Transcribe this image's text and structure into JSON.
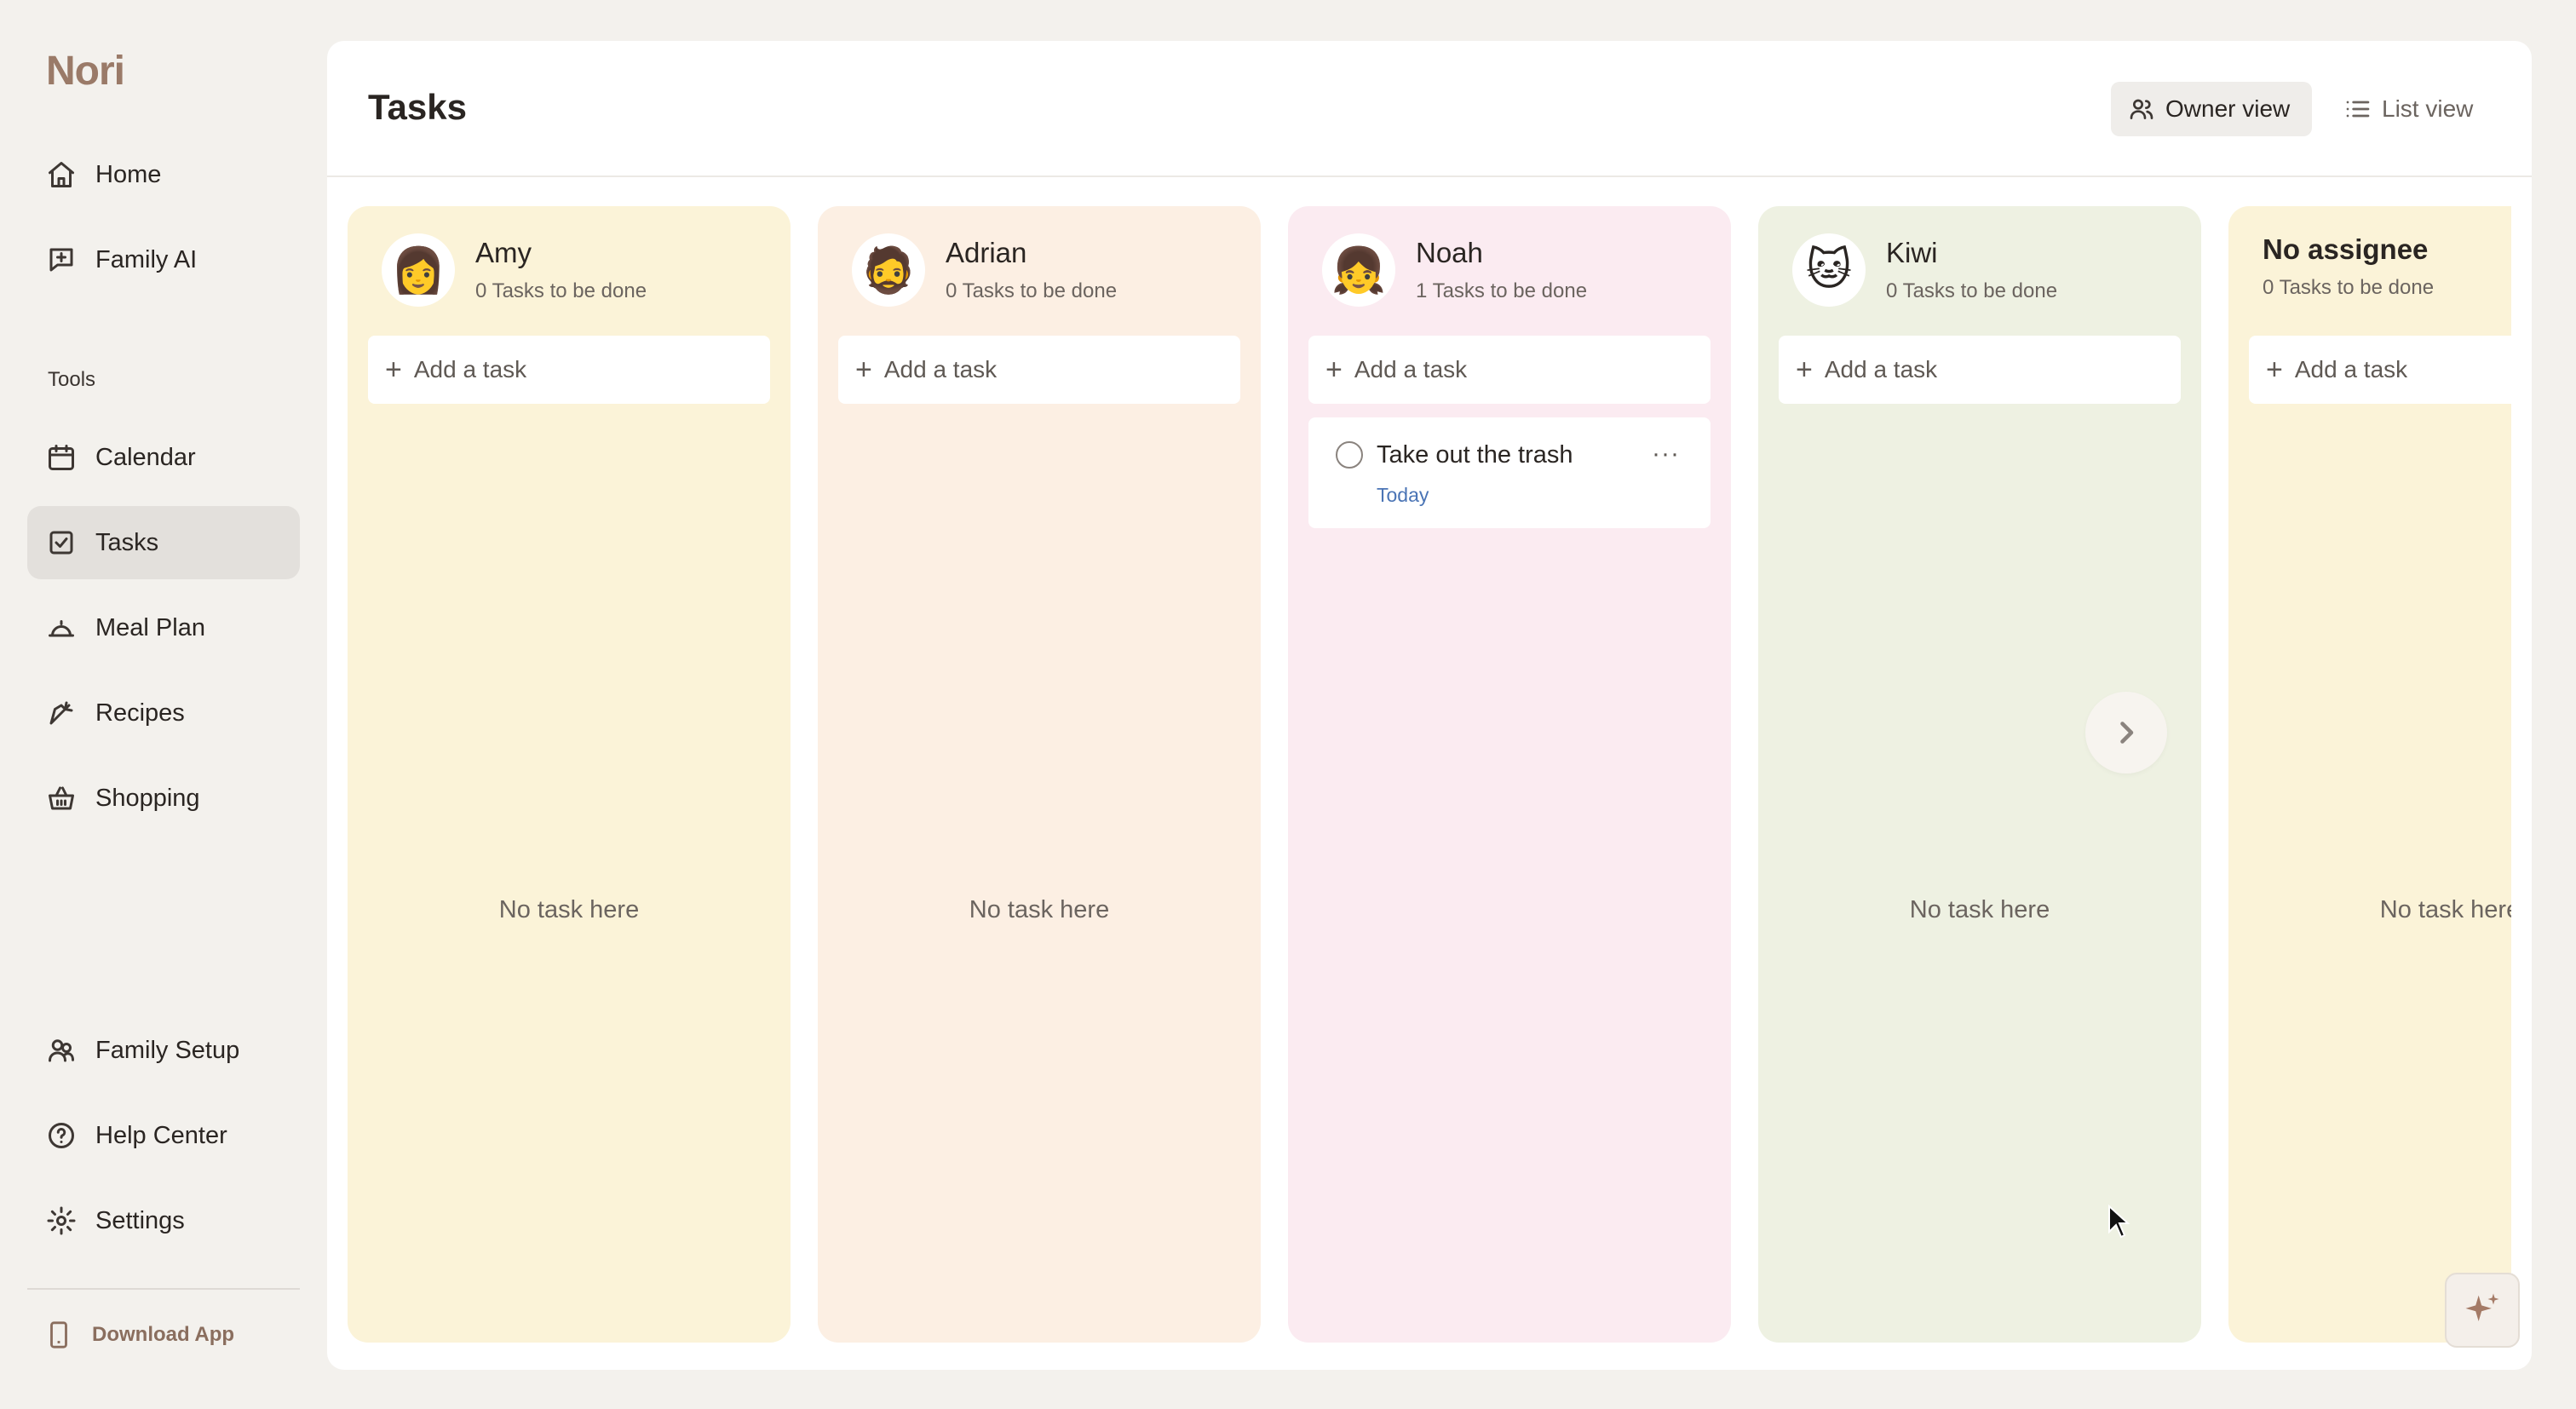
{
  "app": {
    "logo": "Nori"
  },
  "sidebar": {
    "primary": [
      {
        "label": "Home",
        "icon": "home-icon"
      },
      {
        "label": "Family AI",
        "icon": "chat-sparkle-icon"
      }
    ],
    "section_label": "Tools",
    "tools": [
      {
        "label": "Calendar",
        "icon": "calendar-icon"
      },
      {
        "label": "Tasks",
        "icon": "checkbox-icon",
        "active": true
      },
      {
        "label": "Meal Plan",
        "icon": "cloche-icon"
      },
      {
        "label": "Recipes",
        "icon": "carrot-icon"
      },
      {
        "label": "Shopping",
        "icon": "basket-icon"
      }
    ],
    "bottom": [
      {
        "label": "Family Setup",
        "icon": "family-icon"
      },
      {
        "label": "Help Center",
        "icon": "help-icon"
      },
      {
        "label": "Settings",
        "icon": "gear-icon"
      }
    ],
    "download": "Download App"
  },
  "header": {
    "title": "Tasks",
    "owner_view": "Owner view",
    "list_view": "List view"
  },
  "columns": [
    {
      "name": "Amy",
      "count": "0 Tasks to be done",
      "add": "Add a task",
      "empty": "No task here",
      "bg": "#fbf3d8",
      "avatar": "👩"
    },
    {
      "name": "Adrian",
      "count": "0 Tasks to be done",
      "add": "Add a task",
      "empty": "No task here",
      "bg": "#fcefe3",
      "avatar": "🧔"
    },
    {
      "name": "Noah",
      "count": "1 Tasks to be done",
      "add": "Add a task",
      "bg": "#fbebf1",
      "avatar": "👧",
      "tasks": [
        {
          "title": "Take out the trash",
          "due": "Today",
          "more": "···"
        }
      ]
    },
    {
      "name": "Kiwi",
      "count": "0 Tasks to be done",
      "add": "Add a task",
      "empty": "No task here",
      "bg": "#eef1e2",
      "avatar": "🐱"
    },
    {
      "name": "No assignee",
      "count": "0 Tasks to be done",
      "add": "Add a task",
      "empty": "No task here",
      "bg": "#fbf3d8"
    }
  ],
  "colors": {
    "accent": "#9a7a68",
    "due": "#4a74b5",
    "active_nav": "#e3e0dc"
  }
}
